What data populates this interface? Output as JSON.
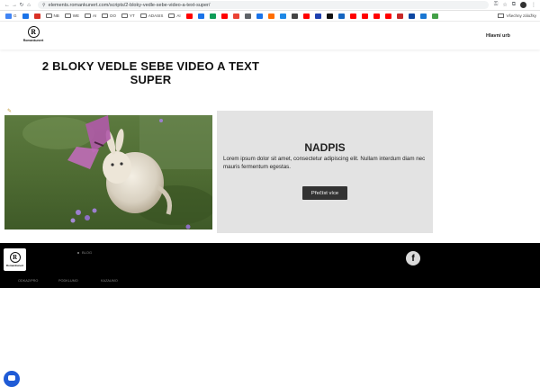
{
  "browser": {
    "url": "elements.romankunert.com/scripts/2-bloky-vedle-sebe-video-a-text-super/",
    "bookmarks": [
      {
        "label": "G",
        "color": "#4285f4"
      },
      {
        "label": "",
        "color": "#1a73e8"
      },
      {
        "label": "",
        "color": "#d93025",
        "folder": false
      },
      {
        "label": "NB",
        "folder": true
      },
      {
        "label": "WE",
        "folder": true
      },
      {
        "label": "AI",
        "folder": true
      },
      {
        "label": "DO",
        "folder": true
      },
      {
        "label": "YT",
        "folder": true
      },
      {
        "label": "ADASIS",
        "folder": true
      },
      {
        "label": "AI",
        "folder": true
      },
      {
        "label": "",
        "color": "#ff0000"
      },
      {
        "label": "",
        "color": "#1a73e8"
      },
      {
        "label": "",
        "color": "#0f9d58"
      },
      {
        "label": "",
        "color": "#ff0000"
      },
      {
        "label": "",
        "color": "#ea4335"
      },
      {
        "label": "",
        "color": "#5f6368"
      },
      {
        "label": "",
        "color": "#1a73e8"
      },
      {
        "label": "",
        "color": "#ff6d00"
      },
      {
        "label": "",
        "color": "#1e88e5"
      },
      {
        "label": "",
        "color": "#444"
      },
      {
        "label": "",
        "color": "#ff0000"
      },
      {
        "label": "",
        "color": "#1e40af"
      },
      {
        "label": "",
        "color": "#111"
      },
      {
        "label": "",
        "color": "#1565c0"
      },
      {
        "label": "",
        "color": "#ff0000"
      },
      {
        "label": "",
        "color": "#ff0000"
      },
      {
        "label": "",
        "color": "#ff0000"
      },
      {
        "label": "",
        "color": "#ff0000"
      },
      {
        "label": "",
        "color": "#c62828"
      },
      {
        "label": "",
        "color": "#0d47a1"
      },
      {
        "label": "",
        "color": "#1976d2"
      },
      {
        "label": "",
        "color": "#43a047"
      }
    ],
    "all_bookmarks": "Všechny záložky"
  },
  "header": {
    "brand": "Romankunert",
    "menu_link": "Hlavní urb"
  },
  "main": {
    "title": "2 BLOKY VEDLE SEBE VIDEO A TEXT SUPER",
    "heading": "NADPIS",
    "text": "Lorem ipsum dolor sit amet, consectetur adipiscing elit. Nullam interdum diam nec mauris fermentum egestas.",
    "button": "Přečíst více"
  },
  "footer": {
    "brand": "Romankunert",
    "bullet": "BLOG",
    "links": [
      "ODKAZ/PRO",
      "PODKLUMO",
      "KAZAUMO"
    ]
  },
  "colors": {
    "footer_bg": "#000000",
    "textbox_bg": "#e3e3e3",
    "button_bg": "#333333",
    "chat": "#1f5bd6"
  }
}
